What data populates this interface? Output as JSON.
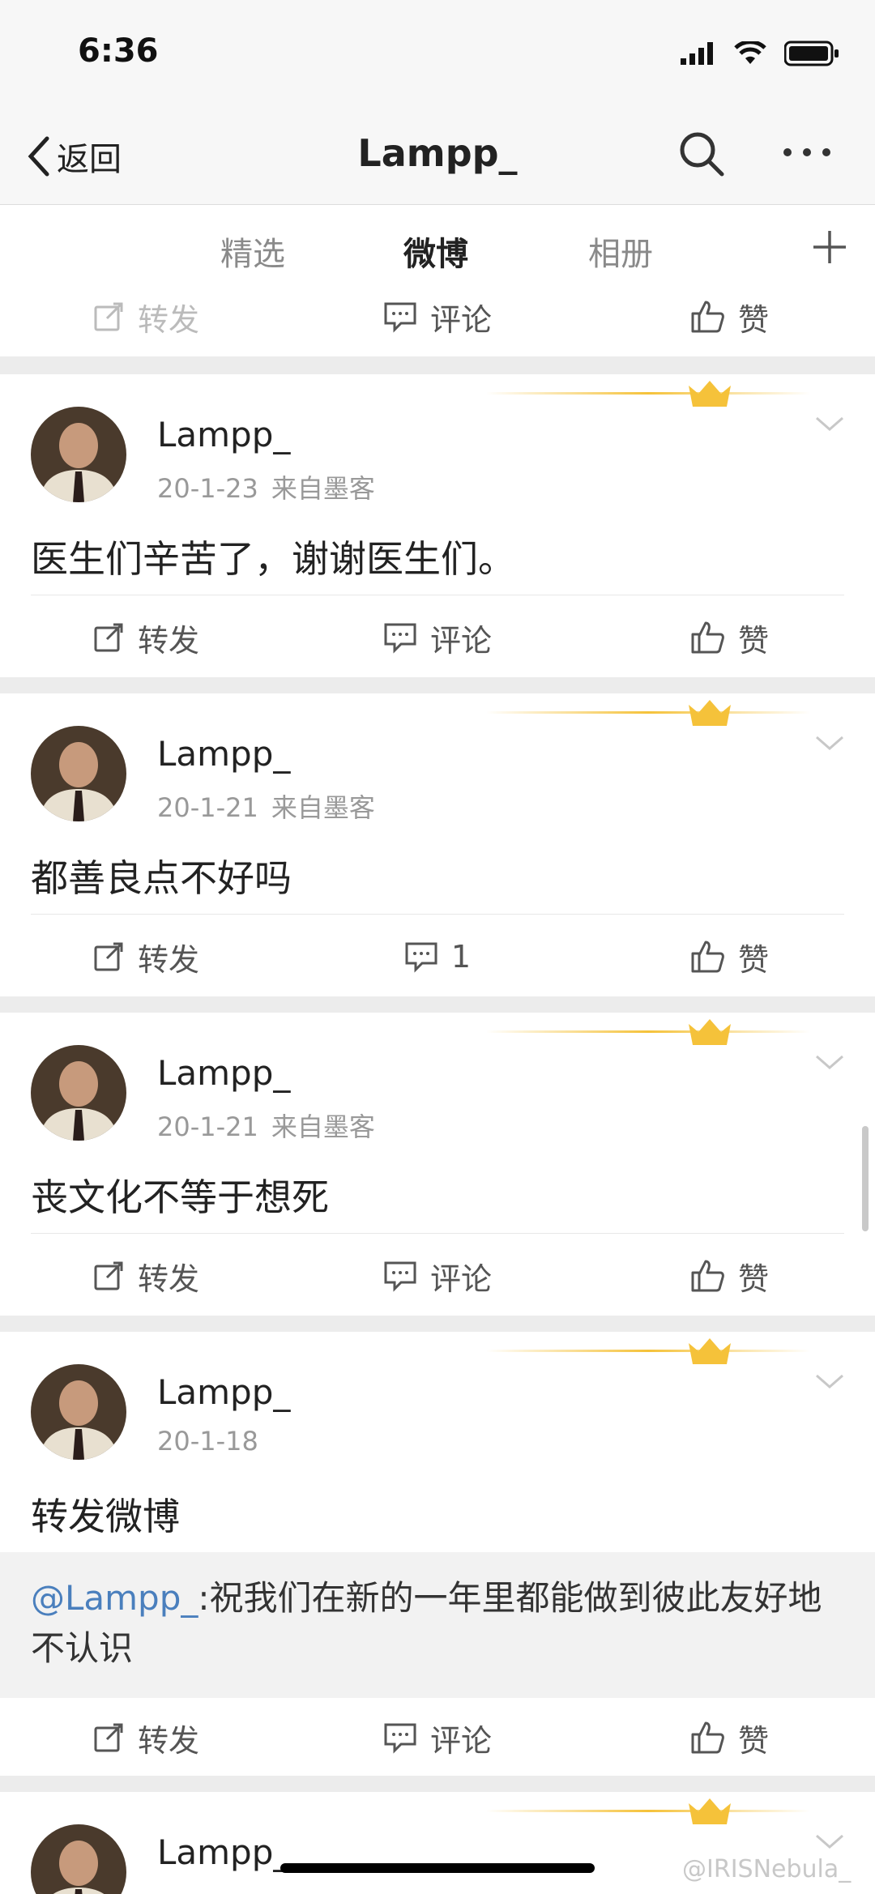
{
  "status": {
    "time": "6:36"
  },
  "nav": {
    "back": "返回",
    "title": "Lampp_"
  },
  "tabs": [
    "精选",
    "微博",
    "相册"
  ],
  "top_actions": {
    "repost": "转发",
    "comment": "评论",
    "like": "赞"
  },
  "posts": [
    {
      "user": "Lampp_",
      "date": "20-1-23",
      "source": "来自墨客",
      "text": "医生们辛苦了，谢谢医生们。",
      "repost": "转发",
      "comment": "评论",
      "like": "赞"
    },
    {
      "user": "Lampp_",
      "date": "20-1-21",
      "source": "来自墨客",
      "text": "都善良点不好吗",
      "repost": "转发",
      "comment": "1",
      "like": "赞"
    },
    {
      "user": "Lampp_",
      "date": "20-1-21",
      "source": "来自墨客",
      "text": "丧文化不等于想死",
      "repost": "转发",
      "comment": "评论",
      "like": "赞"
    },
    {
      "user": "Lampp_",
      "date": "20-1-18",
      "text": "转发微博",
      "quote_mention": "@Lampp_",
      "quote_text": ":祝我们在新的一年里都能做到彼此友好地不认识",
      "repost": "转发",
      "comment": "评论",
      "like": "赞"
    },
    {
      "user": "Lampp_"
    }
  ],
  "watermark": "@IRISNebula_",
  "colors": {
    "accent": "#ff7a2d",
    "mention": "#4a7fbd",
    "crown": "#f5c23a"
  }
}
